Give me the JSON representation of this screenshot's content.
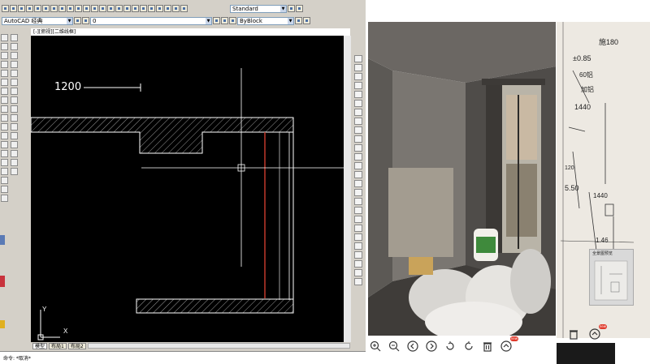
{
  "cad": {
    "layer_combo": "AutoCAD 经典",
    "layer_value": "0",
    "style_combo": "Standard",
    "linetype_combo": "ByBlock",
    "drawing_title": "[-][俯视][二维线框]",
    "dimension_label": "1200",
    "ucs_x": "X",
    "ucs_y": "Y",
    "layout_tabs": [
      "模型",
      "布局1",
      "布局2"
    ],
    "command_text": "命令: *取消*"
  },
  "photo_viewer": {
    "new_badge": "new",
    "toolbar_icons": [
      "zoom-in-icon",
      "zoom-out-icon",
      "prev-icon",
      "next-icon",
      "rotate-left-icon",
      "rotate-right-icon",
      "delete-icon",
      "more-icon"
    ]
  },
  "sketch_viewer": {
    "thumb_label": "全景图预览",
    "new_badge": "new",
    "notes": [
      "±0.85",
      "施180",
      "60铝",
      "加铝",
      "1440",
      "5.50",
      "120",
      "1440",
      "1.46"
    ]
  }
}
